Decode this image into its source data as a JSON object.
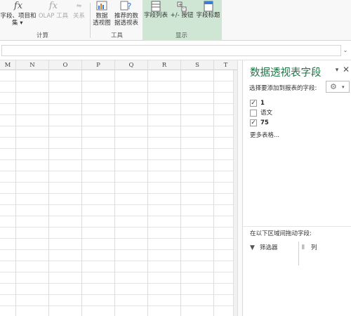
{
  "ribbon": {
    "calc_group": {
      "label": "计算",
      "fields_items_sets": {
        "label_line1": "字段、项目和",
        "label_line2": "集",
        "icon": "fx-icon"
      },
      "olap_tools": {
        "label": "OLAP 工具",
        "icon": "fx-icon"
      },
      "relationships": {
        "label": "关系",
        "icon": "relationships-icon"
      }
    },
    "tools_group": {
      "label": "工具",
      "pivotchart": {
        "label_line1": "数据",
        "label_line2": "透视图",
        "icon": "pivotchart-icon"
      },
      "recommended": {
        "label_line1": "推荐的数",
        "label_line2": "据透视表",
        "icon": "recommended-pivot-icon"
      }
    },
    "show_group": {
      "label": "显示",
      "field_list": {
        "label": "字段列表",
        "icon": "field-list-icon"
      },
      "buttons": {
        "label": "+/- 按钮",
        "icon": "plus-minus-buttons-icon"
      },
      "headers": {
        "label": "字段标题",
        "icon": "field-headers-icon"
      },
      "highlight_color": "#cfe6d4"
    }
  },
  "grid": {
    "columns": [
      "M",
      "N",
      "O",
      "P",
      "Q",
      "R",
      "S",
      "T"
    ]
  },
  "pivot_pane": {
    "title": "数据透视表字段",
    "title_color": "#217346",
    "choose_fields_label": "选择要添加到报表的字段:",
    "fields": [
      {
        "label": "1",
        "checked": true,
        "bold": true
      },
      {
        "label": "语文",
        "checked": false,
        "bold": false
      },
      {
        "label": "75",
        "checked": true,
        "bold": true
      }
    ],
    "more_tables": "更多表格...",
    "drag_label": "在以下区域间拖动字段:",
    "filters_label": "筛选器",
    "columns_label": "列"
  }
}
